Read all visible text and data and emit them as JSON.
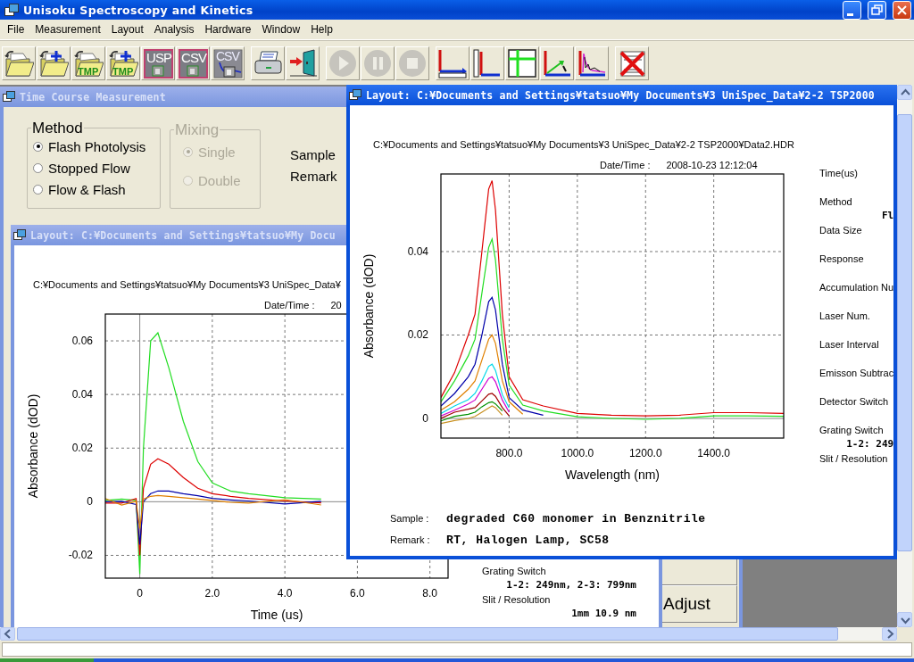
{
  "window": {
    "title": "Unisoku Spectroscopy and Kinetics"
  },
  "menu": [
    "File",
    "Measurement",
    "Layout",
    "Analysis",
    "Hardware",
    "Window",
    "Help"
  ],
  "toolbar": [
    [
      {
        "kind": "folder-open",
        "disabled": false
      },
      {
        "kind": "folder-new",
        "disabled": false
      },
      {
        "kind": "folder-tmp",
        "label": "TMP",
        "disabled": false
      },
      {
        "kind": "folder-tmp-new",
        "label": "TMP",
        "disabled": false
      },
      {
        "kind": "file-tag",
        "label": "USP",
        "disabled": false
      },
      {
        "kind": "file-tag",
        "label": "CSV",
        "disabled": false
      },
      {
        "kind": "file-tag-graph",
        "label": "CSV",
        "disabled": false
      }
    ],
    [
      {
        "kind": "printer",
        "disabled": false
      },
      {
        "kind": "exit-door",
        "disabled": false
      }
    ],
    [
      {
        "kind": "play",
        "disabled": true
      },
      {
        "kind": "pause",
        "disabled": true
      },
      {
        "kind": "stop",
        "disabled": true
      }
    ],
    [
      {
        "kind": "x-axis",
        "disabled": false
      },
      {
        "kind": "y-axis",
        "disabled": false
      },
      {
        "kind": "cross-grid",
        "disabled": false
      },
      {
        "kind": "arrow-graph",
        "disabled": false
      },
      {
        "kind": "decay-graph",
        "disabled": false
      }
    ],
    [
      {
        "kind": "delete-layout",
        "disabled": false
      }
    ]
  ],
  "time_course_window": {
    "title": "Time Course Measurement",
    "active": false,
    "method": {
      "legend": "Method",
      "disabled": false,
      "options": [
        {
          "label": "Flash Photolysis",
          "selected": true
        },
        {
          "label": "Stopped Flow",
          "selected": false
        },
        {
          "label": "Flow & Flash",
          "selected": false
        }
      ]
    },
    "mixing": {
      "legend": "Mixing",
      "disabled": true,
      "options": [
        {
          "label": "Single",
          "selected": true
        },
        {
          "label": "Double",
          "selected": false
        }
      ]
    },
    "labels": [
      "Sample",
      "Remark"
    ],
    "adjust_button": "Adjust"
  },
  "layout_windows": [
    {
      "title": "Layout: C:¥Documents and Settings¥tatsuo¥My Docu",
      "active": false,
      "path": "C:¥Documents and Settings¥tatsuo¥My Documents¥3 UniSpec_Data¥",
      "date_label": "Date/Time :",
      "date_value": "20",
      "chart_data": {
        "type": "line",
        "grid": true,
        "xlabel": "Time (us)",
        "ylabel": "Absorbance (dOD)",
        "xlim": [
          -0.95,
          8.5
        ],
        "ylim": [
          -0.0285,
          0.07
        ],
        "xticks": [
          {
            "value": 0,
            "label": "0"
          },
          {
            "value": 2,
            "label": "2.0"
          },
          {
            "value": 4,
            "label": "4.0"
          },
          {
            "value": 6,
            "label": "6.0"
          },
          {
            "value": 8,
            "label": "8.0"
          }
        ],
        "yticks": [
          -0.02,
          0,
          0.02,
          0.04,
          0.06
        ],
        "x": [
          -0.95,
          -0.5,
          -0.1,
          0,
          0.1,
          0.3,
          0.5,
          0.8,
          1.2,
          1.6,
          2.0,
          2.5,
          3,
          4,
          5
        ],
        "series": [
          {
            "color": "#22dd22",
            "values": [
              0.0005,
              0.001,
              0.0005,
              -0.027,
              0.02,
              0.06,
              0.063,
              0.05,
              0.03,
              0.015,
              0.007,
              0.004,
              0.003,
              0.0015,
              0.001
            ]
          },
          {
            "color": "#dd0000",
            "values": [
              -0.0005,
              -0.0005,
              0.0012,
              -0.02,
              0.005,
              0.014,
              0.016,
              0.014,
              0.009,
              0.005,
              0.003,
              0.002,
              0.0012,
              0.0003,
              -0.0004
            ]
          },
          {
            "color": "#0000aa",
            "values": [
              0,
              0.0002,
              -0.001,
              -0.016,
              0,
              0.003,
              0.004,
              0.004,
              0.003,
              0.0022,
              0.0012,
              0.0007,
              0.0003,
              -0.0008,
              0.0002
            ]
          },
          {
            "color": "#e08000",
            "values": [
              0.0012,
              -0.0012,
              0.0002,
              -0.01,
              0.001,
              0.002,
              0.0023,
              0.002,
              0.0015,
              0.001,
              0.0005,
              -0.0002,
              -0.0005,
              0.0008,
              -0.0012
            ]
          }
        ]
      },
      "info": [
        {
          "kind": "label",
          "text": "Grating Switch"
        },
        {
          "kind": "value",
          "text": "1-2: 249nm, 2-3: 799nm"
        },
        {
          "kind": "label",
          "text": "Slit / Resolution"
        },
        {
          "kind": "value",
          "text": "1mm 10.9 nm"
        }
      ]
    },
    {
      "title": "Layout: C:¥Documents and Settings¥tatsuo¥My Documents¥3 UniSpec_Data¥2-2 TSP2000",
      "active": true,
      "path": "C:¥Documents and Settings¥tatsuo¥My Documents¥3 UniSpec_Data¥2-2 TSP2000¥Data2.HDR",
      "date_label": "Date/Time :",
      "date_value": "2008-10-23 12:12:04",
      "chart_data": {
        "type": "line",
        "grid": true,
        "xlabel": "Wavelength (nm)",
        "ylabel": "Absorbance (dOD)",
        "xlim": [
          600,
          1605
        ],
        "ylim": [
          -0.0047,
          0.0586
        ],
        "xticks": [
          {
            "value": 800,
            "label": "800.0"
          },
          {
            "value": 1000,
            "label": "1000.0"
          },
          {
            "value": 1200,
            "label": "1200.0"
          },
          {
            "value": 1400,
            "label": "1400.0"
          }
        ],
        "yticks": [
          0,
          0.02,
          0.04
        ],
        "x": [
          600,
          640,
          680,
          700,
          720,
          740,
          750,
          760,
          780,
          800,
          840,
          900,
          1000,
          1100,
          1200,
          1300,
          1400,
          1500,
          1605
        ],
        "series": [
          {
            "color": "#dd0000",
            "values": [
              0.005,
              0.011,
              0.02,
              0.025,
              0.04,
              0.055,
              0.057,
              0.05,
              0.025,
              0.01,
              0.0045,
              0.003,
              0.0012,
              0.0008,
              0.0006,
              0.0008,
              0.0014,
              0.0014,
              0.0012
            ]
          },
          {
            "color": "#22dd22",
            "values": [
              0.004,
              0.009,
              0.015,
              0.019,
              0.03,
              0.041,
              0.043,
              0.038,
              0.019,
              0.008,
              0.0032,
              0.0018,
              0.0004,
              0,
              -0.0002,
              0,
              0.0006,
              0.0006,
              0.0005
            ]
          },
          {
            "color": "#0000aa",
            "values": [
              0.003,
              0.006,
              0.01,
              0.013,
              0.02,
              0.028,
              0.029,
              0.026,
              0.013,
              0.005,
              0.002,
              0.0008,
              null,
              null,
              null,
              null,
              null,
              null,
              null
            ]
          },
          {
            "color": "#e08000",
            "values": [
              0.002,
              0.004,
              0.007,
              0.009,
              0.014,
              0.019,
              0.02,
              0.018,
              0.009,
              0.004,
              0.001,
              null,
              null,
              null,
              null,
              null,
              null,
              null,
              null
            ]
          },
          {
            "color": "#00d8e8",
            "values": [
              0.0012,
              0.003,
              0.0045,
              0.006,
              0.009,
              0.0125,
              0.013,
              0.0115,
              0.0057,
              0.0025,
              null,
              null,
              null,
              null,
              null,
              null,
              null,
              null,
              null
            ]
          },
          {
            "color": "#d000d0",
            "values": [
              0.0006,
              0.002,
              0.0035,
              0.0044,
              0.007,
              0.0096,
              0.01,
              0.0088,
              0.0044,
              0.0015,
              null,
              null,
              null,
              null,
              null,
              null,
              null,
              null,
              null
            ]
          },
          {
            "color": "#a00000",
            "values": [
              0,
              0.0015,
              0.0022,
              0.0026,
              0.0042,
              0.0058,
              0.006,
              0.0053,
              0.0026,
              0.0006,
              null,
              null,
              null,
              null,
              null,
              null,
              null,
              null,
              null
            ]
          },
          {
            "color": "#009000",
            "values": [
              -0.0006,
              0.0005,
              0.001,
              0.0015,
              0.0028,
              0.0038,
              0.004,
              0.0035,
              0.0018,
              null,
              null,
              null,
              null,
              null,
              null,
              null,
              null,
              null,
              null
            ]
          },
          {
            "color": "#c89020",
            "values": [
              -0.0012,
              -0.0005,
              0,
              0.0005,
              0.0015,
              0.0025,
              0.003,
              0.0026,
              0.0008,
              null,
              null,
              null,
              null,
              null,
              null,
              null,
              null,
              null,
              null
            ]
          }
        ]
      },
      "info": [
        {
          "kind": "label",
          "text": "Time(us)"
        },
        {
          "kind": "label",
          "text": "Method"
        },
        {
          "kind": "value",
          "text": "Fl"
        },
        {
          "kind": "label",
          "text": "Data Size"
        },
        {
          "kind": "label",
          "text": "Response"
        },
        {
          "kind": "label",
          "text": "Accumulation Nu"
        },
        {
          "kind": "label",
          "text": "Laser Num."
        },
        {
          "kind": "label",
          "text": "Laser Interval"
        },
        {
          "kind": "label",
          "text": "Emisson Subtrac"
        },
        {
          "kind": "label",
          "text": "Detector Switch"
        },
        {
          "kind": "label",
          "text": "Grating Switch"
        },
        {
          "kind": "value",
          "text": "1-2: 249"
        },
        {
          "kind": "label",
          "text": "Slit / Resolution"
        }
      ],
      "sample_label": "Sample :",
      "sample_value": "degraded C60 monomer in Benznitrile",
      "remark_label": "Remark :",
      "remark_value": "RT, Halogen Lamp, SC58"
    }
  ]
}
